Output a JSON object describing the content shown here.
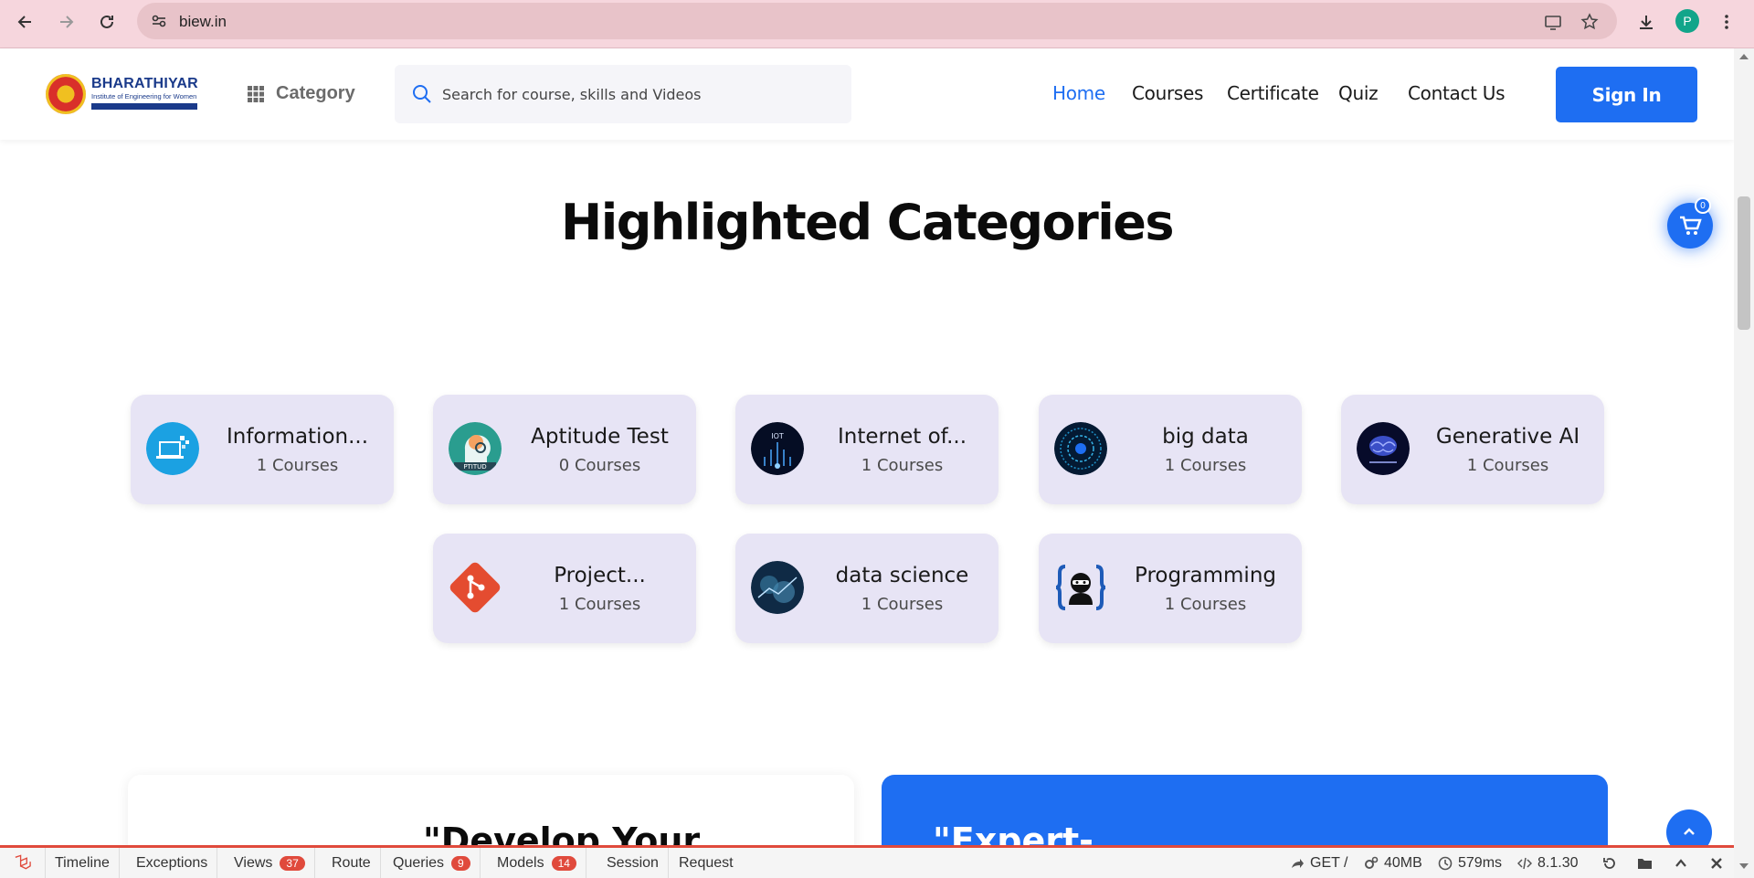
{
  "browser": {
    "url": "biew.in",
    "avatar_initial": "P"
  },
  "header": {
    "logo_title": "BHARATHIYAR",
    "logo_subtitle": "Institute of Engineering for Women",
    "category_label": "Category",
    "search_placeholder": "Search for course, skills and Videos",
    "nav": [
      {
        "label": "Home",
        "active": true
      },
      {
        "label": "Courses",
        "active": false
      },
      {
        "label": "Certificate",
        "active": false
      },
      {
        "label": "Quiz",
        "active": false
      },
      {
        "label": "Contact Us",
        "active": false
      }
    ],
    "signin_label": "Sign In"
  },
  "main": {
    "section_title": "Highlighted Categories",
    "categories": [
      {
        "name": "Information...",
        "count": "1 Courses",
        "icon": "it-computer-icon"
      },
      {
        "name": "Aptitude Test",
        "count": "0 Courses",
        "icon": "aptitude-head-icon"
      },
      {
        "name": "Internet of...",
        "count": "1 Courses",
        "icon": "iot-icon"
      },
      {
        "name": "big data",
        "count": "1 Courses",
        "icon": "big-data-icon"
      },
      {
        "name": "Generative AI",
        "count": "1 Courses",
        "icon": "brain-icon"
      },
      {
        "name": "Project...",
        "count": "1 Courses",
        "icon": "git-icon"
      },
      {
        "name": "data science",
        "count": "1 Courses",
        "icon": "data-science-icon"
      },
      {
        "name": "Programming",
        "count": "1 Courses",
        "icon": "ninja-code-icon"
      }
    ],
    "promo_left": "\"Develop Your",
    "promo_right": "\"Expert-",
    "cart_count": "0"
  },
  "debugbar": {
    "tabs": [
      {
        "label": "Timeline"
      },
      {
        "label": "Exceptions"
      },
      {
        "label": "Views",
        "badge": "37"
      },
      {
        "label": "Route"
      },
      {
        "label": "Queries",
        "badge": "9"
      },
      {
        "label": "Models",
        "badge": "14"
      },
      {
        "label": "Session"
      },
      {
        "label": "Request"
      }
    ],
    "method": "GET /",
    "memory": "40MB",
    "time": "579ms",
    "version": "8.1.30"
  },
  "colors": {
    "accent": "#1e6ef2",
    "card_bg": "#e7e4f5",
    "debug_red": "#e04a3c"
  }
}
